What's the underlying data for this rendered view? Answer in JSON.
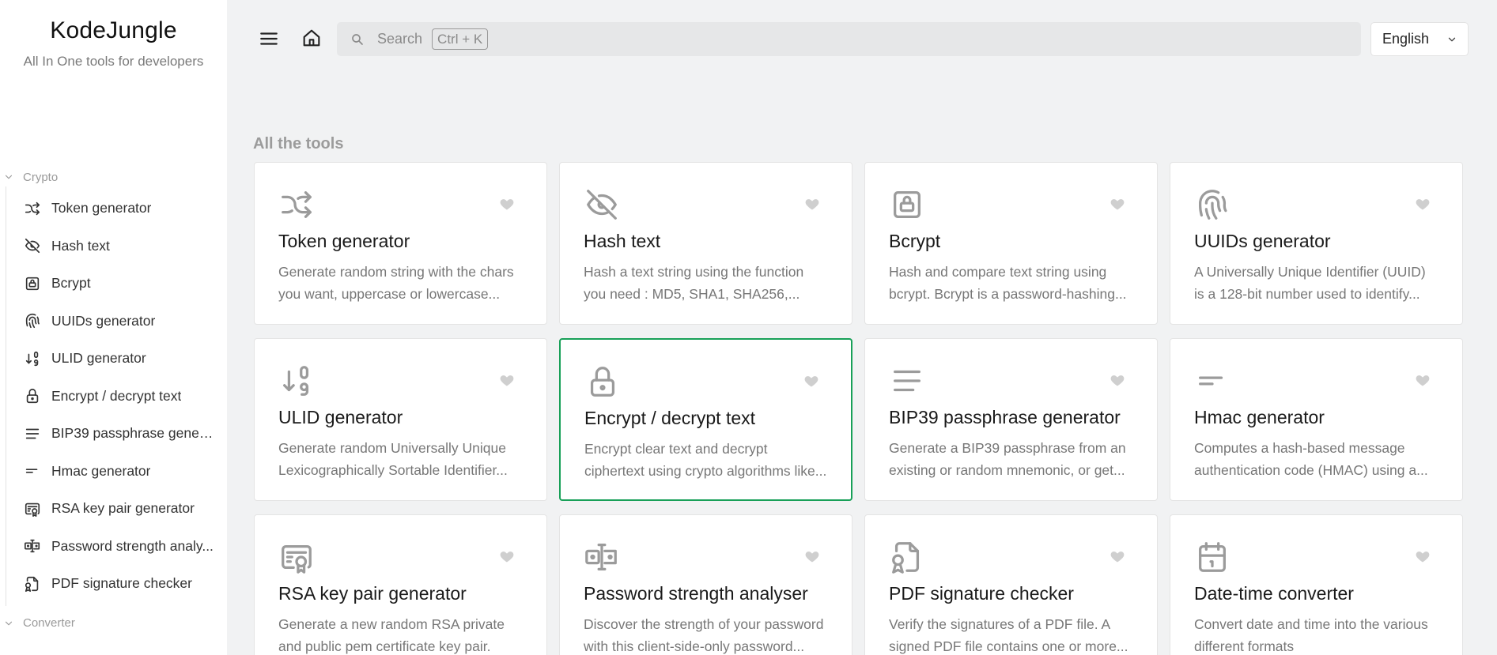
{
  "brand": {
    "title": "KodeJungle",
    "subtitle": "All In One tools for developers"
  },
  "sidebar": {
    "groups": [
      {
        "label": "Crypto",
        "items": [
          {
            "label": "Token generator",
            "icon": "shuffle-icon"
          },
          {
            "label": "Hash text",
            "icon": "eye-off-icon"
          },
          {
            "label": "Bcrypt",
            "icon": "lock-square-icon"
          },
          {
            "label": "UUIDs generator",
            "icon": "fingerprint-icon"
          },
          {
            "label": "ULID generator",
            "icon": "sort-numbers-icon"
          },
          {
            "label": "Encrypt / decrypt text",
            "icon": "lock-icon"
          },
          {
            "label": "BIP39 passphrase gener...",
            "icon": "align-justified-icon"
          },
          {
            "label": "Hmac generator",
            "icon": "short-text-icon"
          },
          {
            "label": "RSA key pair generator",
            "icon": "certificate-icon"
          },
          {
            "label": "Password strength analy...",
            "icon": "password-icon"
          },
          {
            "label": "PDF signature checker",
            "icon": "file-certificate-icon"
          }
        ]
      },
      {
        "label": "Converter",
        "items": []
      }
    ]
  },
  "header": {
    "search_placeholder": "Search",
    "search_shortcut": "Ctrl + K",
    "language": "English"
  },
  "main": {
    "section_title": "All the tools",
    "cards": [
      {
        "title": "Token generator",
        "desc": "Generate random string with the chars you want, uppercase or lowercase...",
        "icon": "shuffle-icon"
      },
      {
        "title": "Hash text",
        "desc": "Hash a text string using the function you need : MD5, SHA1, SHA256,...",
        "icon": "eye-off-icon"
      },
      {
        "title": "Bcrypt",
        "desc": "Hash and compare text string using bcrypt. Bcrypt is a password-hashing...",
        "icon": "lock-square-icon"
      },
      {
        "title": "UUIDs generator",
        "desc": "A Universally Unique Identifier (UUID) is a 128-bit number used to identify...",
        "icon": "fingerprint-icon"
      },
      {
        "title": "ULID generator",
        "desc": "Generate random Universally Unique Lexicographically Sortable Identifier...",
        "icon": "sort-numbers-icon"
      },
      {
        "title": "Encrypt / decrypt text",
        "desc": "Encrypt clear text and decrypt ciphertext using crypto algorithms like...",
        "icon": "lock-icon",
        "active": true
      },
      {
        "title": "BIP39 passphrase generator",
        "desc": "Generate a BIP39 passphrase from an existing or random mnemonic, or get...",
        "icon": "align-justified-icon"
      },
      {
        "title": "Hmac generator",
        "desc": "Computes a hash-based message authentication code (HMAC) using a...",
        "icon": "short-text-icon"
      },
      {
        "title": "RSA key pair generator",
        "desc": "Generate a new random RSA private and public pem certificate key pair.",
        "icon": "certificate-icon"
      },
      {
        "title": "Password strength analyser",
        "desc": "Discover the strength of your password with this client-side-only password...",
        "icon": "password-icon"
      },
      {
        "title": "PDF signature checker",
        "desc": "Verify the signatures of a PDF file. A signed PDF file contains one or more...",
        "icon": "file-certificate-icon"
      },
      {
        "title": "Date-time converter",
        "desc": "Convert date and time into the various different formats",
        "icon": "calendar-icon"
      }
    ]
  },
  "colors": {
    "accent": "#18a058",
    "background": "#f1f2f3",
    "sidebar": "#ffffff",
    "icon": "#9b9b9b"
  }
}
